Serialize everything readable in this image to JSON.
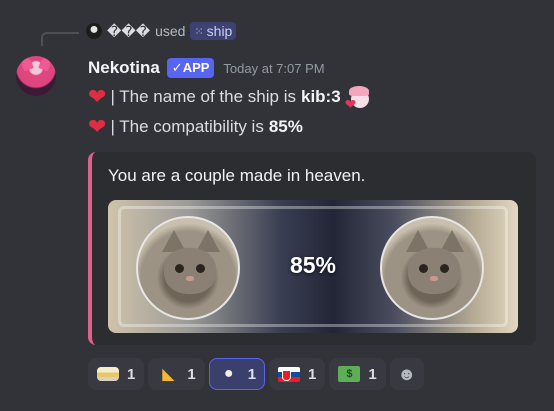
{
  "reply": {
    "username": "���",
    "used_text": "used",
    "command_icon": "app-command-icon",
    "command_name": "ship"
  },
  "message": {
    "author": "Nekotina",
    "badge": "✓APP",
    "timestamp": "Today at 7:07 PM",
    "line1_text": "| The name of the ship is",
    "line1_value": "kib:3",
    "line2_text": "| The compatibility is",
    "line2_value": "85%"
  },
  "embed": {
    "accent_color": "#e0628c",
    "title": "You are a couple made in heaven.",
    "image_percent": "85%",
    "compatibility": 85
  },
  "reactions": [
    {
      "emoji": "butter",
      "count": "1",
      "active": false
    },
    {
      "emoji": "cheese",
      "count": "1",
      "active": false
    },
    {
      "emoji": "garlic",
      "count": "1",
      "active": true
    },
    {
      "emoji": "flag-slovakia",
      "count": "1",
      "active": false
    },
    {
      "emoji": "money-with-wings",
      "count": "1",
      "active": false
    }
  ],
  "add_reaction_icon": "add-reaction-smiley-icon"
}
